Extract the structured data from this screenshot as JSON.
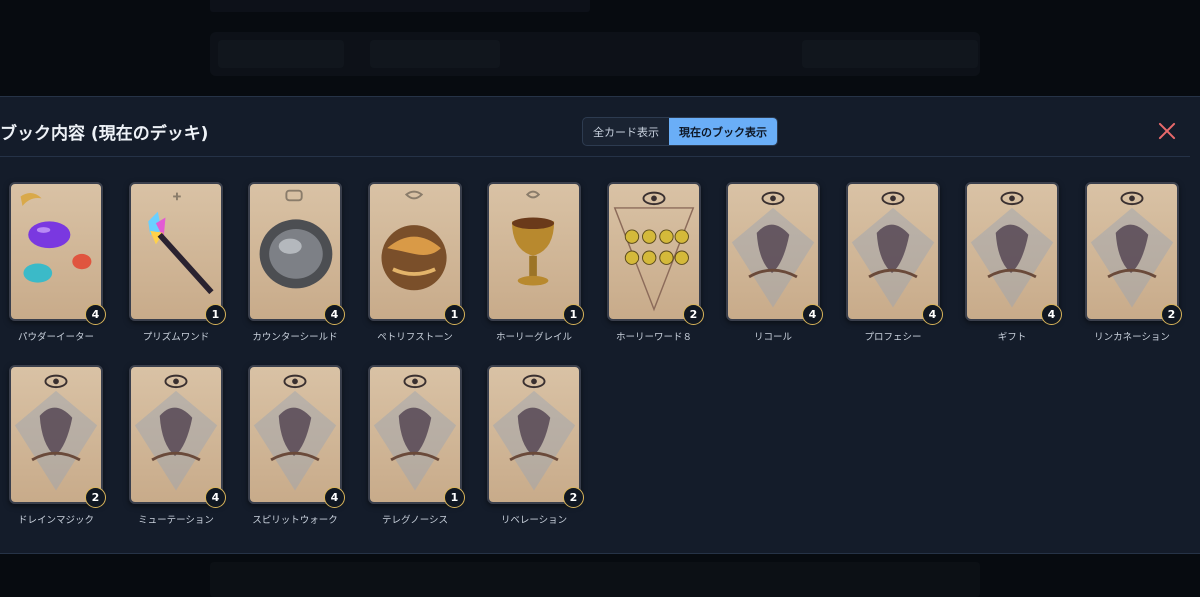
{
  "modal": {
    "title": "ブック内容 (現在のデッキ)",
    "toggle": {
      "all_label": "全カード表示",
      "current_label": "現在のブック表示",
      "active": "current"
    }
  },
  "colors": {
    "accent": "#6aaef7",
    "close": "#e8696b",
    "badge_border": "#d8b45a"
  },
  "cards": [
    {
      "name": "パウダーイーター",
      "count": "4",
      "art": "slime"
    },
    {
      "name": "プリズムワンド",
      "count": "1",
      "art": "wand"
    },
    {
      "name": "カウンターシールド",
      "count": "4",
      "art": "shield"
    },
    {
      "name": "ペトリフストーン",
      "count": "1",
      "art": "stone"
    },
    {
      "name": "ホーリーグレイル",
      "count": "1",
      "art": "grail"
    },
    {
      "name": "ホーリーワード８",
      "count": "2",
      "art": "eight-suns"
    },
    {
      "name": "リコール",
      "count": "4",
      "art": "eye-figure"
    },
    {
      "name": "プロフェシー",
      "count": "4",
      "art": "eye-figure"
    },
    {
      "name": "ギフト",
      "count": "4",
      "art": "eye-figure"
    },
    {
      "name": "リンカネーション",
      "count": "2",
      "art": "eye-figure"
    },
    {
      "name": "ドレインマジック",
      "count": "2",
      "art": "eye-figure"
    },
    {
      "name": "ミューテーション",
      "count": "4",
      "art": "eye-figure"
    },
    {
      "name": "スピリットウォーク",
      "count": "4",
      "art": "eye-figure"
    },
    {
      "name": "テレグノーシス",
      "count": "1",
      "art": "eye-figure"
    },
    {
      "name": "リベレーション",
      "count": "2",
      "art": "eye-figure"
    }
  ]
}
